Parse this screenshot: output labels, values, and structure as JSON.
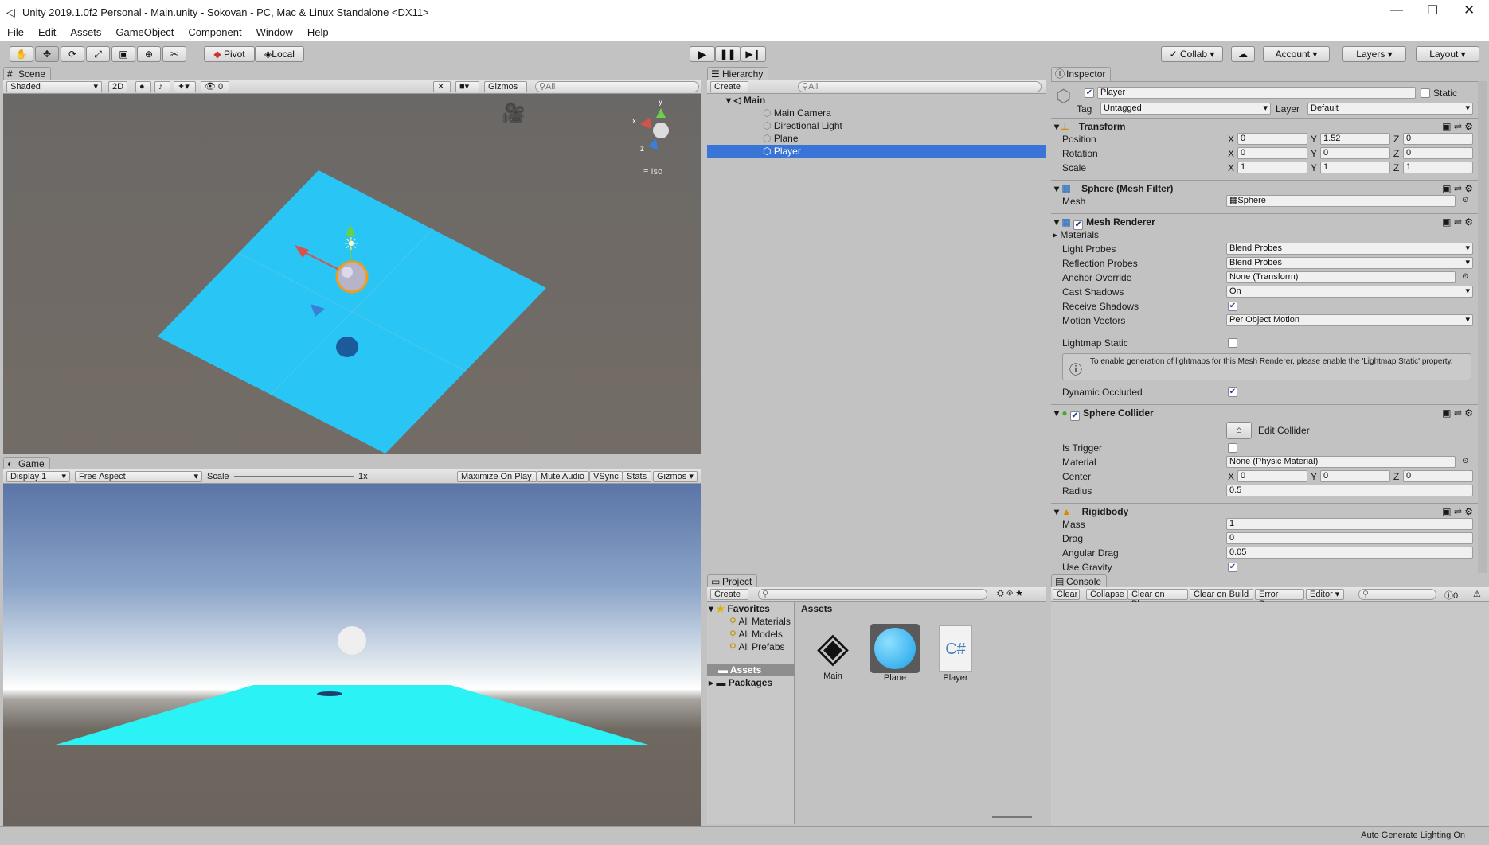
{
  "window": {
    "title": "Unity 2019.1.0f2 Personal - Main.unity - Sokovan - PC, Mac & Linux Standalone <DX11>"
  },
  "menu": [
    "File",
    "Edit",
    "Assets",
    "GameObject",
    "Component",
    "Window",
    "Help"
  ],
  "toolbar": {
    "pivot": "Pivot",
    "local": "Local",
    "collab": "Collab",
    "account": "Account",
    "layers": "Layers",
    "layout": "Layout"
  },
  "scene": {
    "tab": "Scene",
    "shading": "Shaded",
    "mode2d": "2D",
    "fx_count": "0",
    "gizmos": "Gizmos",
    "search_placeholder": "All",
    "projection": "Iso"
  },
  "game": {
    "tab": "Game",
    "display": "Display 1",
    "aspect": "Free Aspect",
    "scale_label": "Scale",
    "scale_value": "1x",
    "maximize": "Maximize On Play",
    "mute": "Mute Audio",
    "vsync": "VSync",
    "stats": "Stats",
    "gizmos": "Gizmos"
  },
  "hierarchy": {
    "tab": "Hierarchy",
    "create": "Create",
    "search_placeholder": "All",
    "scene_name": "Main",
    "items": [
      "Main Camera",
      "Directional Light",
      "Plane",
      "Player"
    ],
    "selected": "Player"
  },
  "inspector": {
    "tab": "Inspector",
    "object_name": "Player",
    "static_label": "Static",
    "tag_label": "Tag",
    "tag_value": "Untagged",
    "layer_label": "Layer",
    "layer_value": "Default",
    "transform": {
      "title": "Transform",
      "position_label": "Position",
      "rotation_label": "Rotation",
      "scale_label": "Scale",
      "position": [
        "0",
        "1.52",
        "0"
      ],
      "rotation": [
        "0",
        "0",
        "0"
      ],
      "scale": [
        "1",
        "1",
        "1"
      ]
    },
    "axes": [
      "X",
      "Y",
      "Z"
    ],
    "mesh_filter": {
      "title": "Sphere (Mesh Filter)",
      "mesh_label": "Mesh",
      "mesh_value": "Sphere"
    },
    "mesh_renderer": {
      "title": "Mesh Renderer",
      "materials": "Materials",
      "light_probes_label": "Light Probes",
      "light_probes": "Blend Probes",
      "reflection_probes_label": "Reflection Probes",
      "reflection_probes": "Blend Probes",
      "anchor_label": "Anchor Override",
      "anchor": "None (Transform)",
      "cast_label": "Cast Shadows",
      "cast": "On",
      "receive_label": "Receive Shadows",
      "motion_label": "Motion Vectors",
      "motion": "Per Object Motion",
      "lightmap_label": "Lightmap Static",
      "help": "To enable generation of lightmaps for this Mesh Renderer, please enable the 'Lightmap Static' property.",
      "dynamic_label": "Dynamic Occluded"
    },
    "sphere_collider": {
      "title": "Sphere Collider",
      "edit": "Edit Collider",
      "trigger_label": "Is Trigger",
      "material_label": "Material",
      "material": "None (Physic Material)",
      "center_label": "Center",
      "center": [
        "0",
        "0",
        "0"
      ],
      "radius_label": "Radius",
      "radius": "0.5"
    },
    "rigidbody": {
      "title": "Rigidbody",
      "mass_label": "Mass",
      "mass": "1",
      "drag_label": "Drag",
      "drag": "0",
      "angular_label": "Angular Drag",
      "angular": "0.05",
      "gravity_label": "Use Gravity"
    }
  },
  "project": {
    "tab": "Project",
    "create": "Create",
    "favorites": "Favorites",
    "fav_items": [
      "All Materials",
      "All Models",
      "All Prefabs"
    ],
    "assets": "Assets",
    "packages": "Packages",
    "header": "Assets",
    "files": [
      "Main",
      "Plane",
      "Player"
    ],
    "cs_glyph": "C#"
  },
  "console": {
    "tab": "Console",
    "buttons": [
      "Clear",
      "Collapse",
      "Clear on Play",
      "Clear on Build",
      "Error Pause",
      "Editor"
    ],
    "count": "0"
  },
  "status": {
    "text": "Auto Generate Lighting On"
  },
  "colors": {
    "accent": "#3875d7",
    "plane": "#29c6f5"
  }
}
